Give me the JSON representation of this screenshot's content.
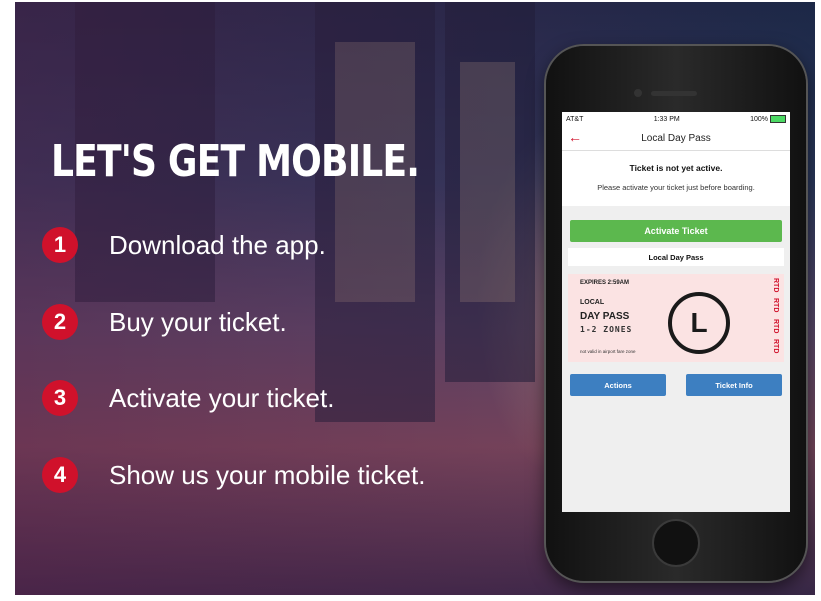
{
  "headline": "LET'S GET MOBILE.",
  "steps": [
    {
      "number": "1",
      "text": "Download the app."
    },
    {
      "number": "2",
      "text": "Buy your ticket."
    },
    {
      "number": "3",
      "text": "Activate your ticket."
    },
    {
      "number": "4",
      "text": "Show us your mobile ticket."
    }
  ],
  "phone": {
    "status": {
      "carrier": "AT&T",
      "time": "1:33 PM",
      "battery": "100%"
    },
    "nav": {
      "back_icon": "back-arrow-icon",
      "title": "Local Day Pass"
    },
    "notice": {
      "title": "Ticket is not yet active.",
      "message": "Please activate your ticket just before boarding."
    },
    "activate_label": "Activate Ticket",
    "pass_label": "Local Day Pass",
    "ticket": {
      "expires": "EXPIRES 2:59AM",
      "type_line1": "LOCAL",
      "type_line2": "DAY PASS",
      "zones": "1-2 ZONES",
      "note": "not valid in airport fare zone",
      "letter": "L",
      "brand": [
        "RTD",
        "RTD",
        "RTD",
        "RTD"
      ]
    },
    "actions_label": "Actions",
    "ticket_info_label": "Ticket Info"
  },
  "colors": {
    "accent_red": "#d0112b",
    "activate_green": "#5cb84e",
    "button_blue": "#3d7fc1"
  }
}
